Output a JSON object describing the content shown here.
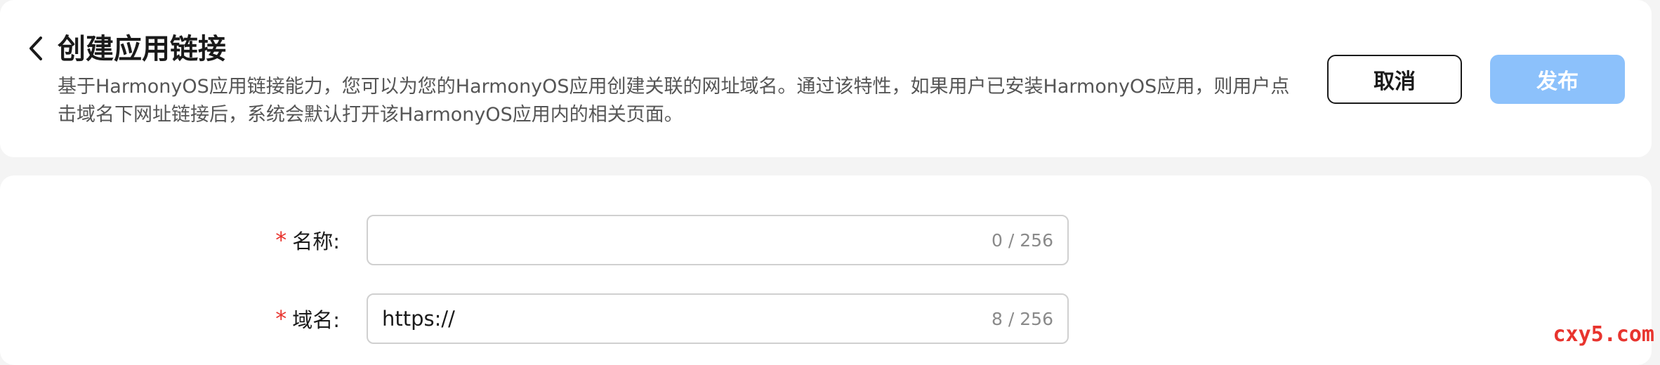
{
  "header": {
    "title": "创建应用链接",
    "description": "基于HarmonyOS应用链接能力，您可以为您的HarmonyOS应用创建关联的网址域名。通过该特性，如果用户已安装HarmonyOS应用，则用户点击域名下网址链接后，系统会默认打开该HarmonyOS应用内的相关页面。",
    "back_icon": "chevron-left-icon",
    "cancel_label": "取消",
    "publish_label": "发布"
  },
  "form": {
    "name_field": {
      "required_mark": "*",
      "label": "名称:",
      "value": "",
      "counter": "0 / 256"
    },
    "domain_field": {
      "required_mark": "*",
      "label": "域名:",
      "value": "https://",
      "counter": "8 / 256"
    }
  },
  "watermark": "cxy5.com",
  "colors": {
    "primary_disabled": "#8cc1fb",
    "required": "#e8342e",
    "border": "#d0d0d0",
    "background": "#f4f4f4"
  }
}
